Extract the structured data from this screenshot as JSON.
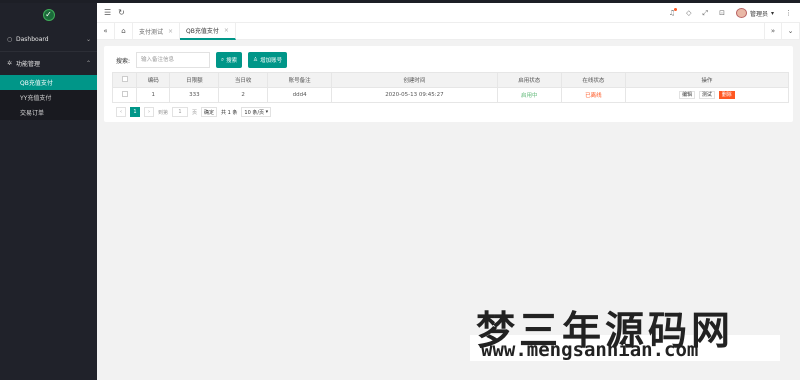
{
  "sidebar": {
    "logo_icon": "leaf-logo",
    "items": [
      {
        "label": "Dashboard",
        "icon": "home-icon"
      },
      {
        "label": "功能管理",
        "icon": "gear-icon"
      }
    ],
    "sub_items": [
      {
        "label": "QB充值支付",
        "active": true
      },
      {
        "label": "YY充值支付",
        "active": false
      },
      {
        "label": "交易订单",
        "active": false
      }
    ]
  },
  "header": {
    "user_name": "管理员"
  },
  "tabs": {
    "items": [
      {
        "label": "支付测试"
      },
      {
        "label": "QB充值支付"
      }
    ]
  },
  "toolbar": {
    "search_label": "搜索:",
    "search_placeholder": "输入备注信息",
    "search_button": "搜索",
    "add_button": "增加账号"
  },
  "table": {
    "columns": [
      "编码",
      "日限额",
      "当日收",
      "账号备注",
      "创建时间",
      "启用状态",
      "在线状态",
      "操作"
    ],
    "rows": [
      {
        "id": "1",
        "limit": "333",
        "today": "2",
        "note": "ddd4",
        "created": "2020-05-13 09:45:27",
        "enabled": "启用中",
        "online": "已离线",
        "ops": [
          "编辑",
          "测试",
          "删除"
        ]
      }
    ]
  },
  "pager": {
    "prev": "‹",
    "current": "1",
    "next": "›",
    "goto_label": "到第",
    "goto_value": "1",
    "page_unit": "页",
    "confirm": "确定",
    "total": "共 1 条",
    "per_page": "10 条/页"
  },
  "watermark": {
    "line1": "梦三年源码网",
    "line2": "www.mengsannian.com"
  },
  "colors": {
    "accent": "#009688",
    "sidebar": "#20222a",
    "danger": "#ff5722"
  }
}
